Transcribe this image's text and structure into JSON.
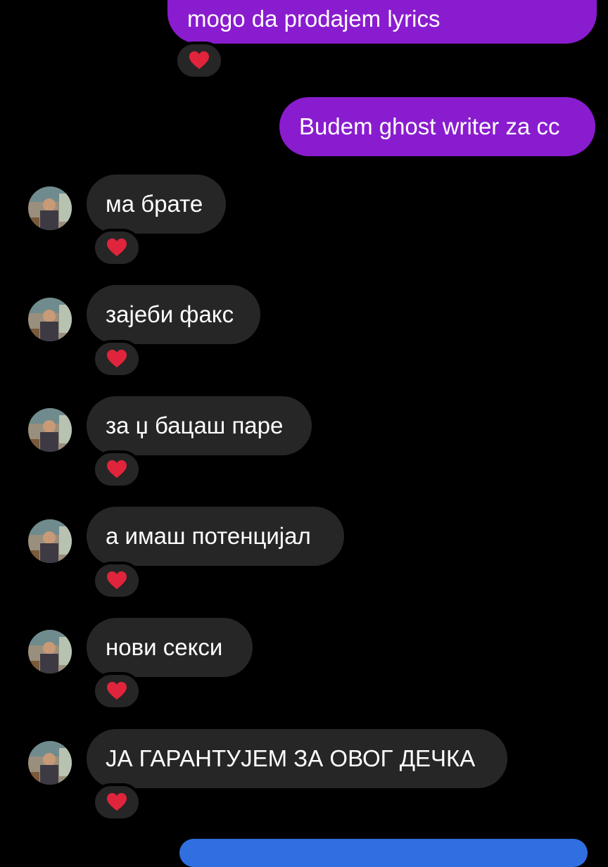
{
  "conversation": {
    "sent_messages": [
      {
        "text": "mogo da prodajem lyrics"
      },
      {
        "text": "Budem ghost writer za cc"
      }
    ],
    "received_messages": [
      {
        "text": "ма брате"
      },
      {
        "text": "зајеби факс"
      },
      {
        "text": "за џ бацаш паре"
      },
      {
        "text": "а имаш потенцијал"
      },
      {
        "text": "нови секси"
      },
      {
        "text": "ЈА ГАРАНТУЈЕМ ЗА ОВОГ ДЕЧКА"
      }
    ],
    "reaction_icon": "red-heart-icon",
    "avatar_icon": "contact-avatar"
  },
  "colors": {
    "background": "#000000",
    "sent_bubble": "#8a1ccf",
    "received_bubble": "#262626",
    "text": "#ffffff",
    "heart": "#e0243c",
    "partial_bubble": "#2f6fe0"
  }
}
